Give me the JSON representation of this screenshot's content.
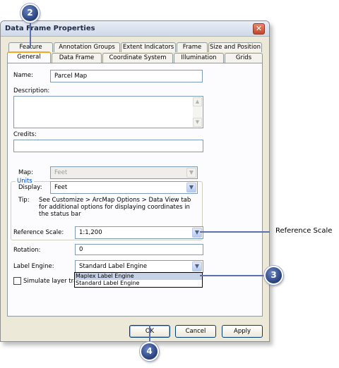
{
  "window": {
    "title": "Data Frame Properties",
    "close_glyph": "✕"
  },
  "tabs": {
    "row1": [
      "Feature Cache",
      "Annotation Groups",
      "Extent Indicators",
      "Frame",
      "Size and Position"
    ],
    "row2": [
      "General",
      "Data Frame",
      "Coordinate System",
      "Illumination",
      "Grids"
    ]
  },
  "general": {
    "name_label": "Name:",
    "name_value": "Parcel Map",
    "description_label": "Description:",
    "credits_label": "Credits:",
    "units_group": "Units",
    "map_label": "Map:",
    "map_value": "Feet",
    "display_label": "Display:",
    "display_value": "Feet",
    "tip_label": "Tip:",
    "tip_text": "See Customize > ArcMap Options > Data View tab for additional options for displaying coordinates in the status bar",
    "reference_scale_label": "Reference Scale:",
    "reference_scale_value": "1:1,200",
    "rotation_label": "Rotation:",
    "rotation_value": "0",
    "label_engine_label": "Label Engine:",
    "label_engine_value": "Standard Label Engine",
    "label_engine_options": [
      "Maplex Label Engine",
      "Standard Label Engine"
    ],
    "simulate_label": "Simulate layer trans"
  },
  "buttons": {
    "ok": "OK",
    "cancel": "Cancel",
    "apply": "Apply"
  },
  "callouts": {
    "c2": "2",
    "c3": "3",
    "c4": "4",
    "reference_scale_annotation": "Reference Scale"
  },
  "icons": {
    "dropdown": "▼",
    "scroll_up": "▲",
    "scroll_down": "▼"
  },
  "colors": {
    "callout": "#27407c",
    "leader_line": "#5c6fb3",
    "active_tab_accent": "#f5a623"
  }
}
